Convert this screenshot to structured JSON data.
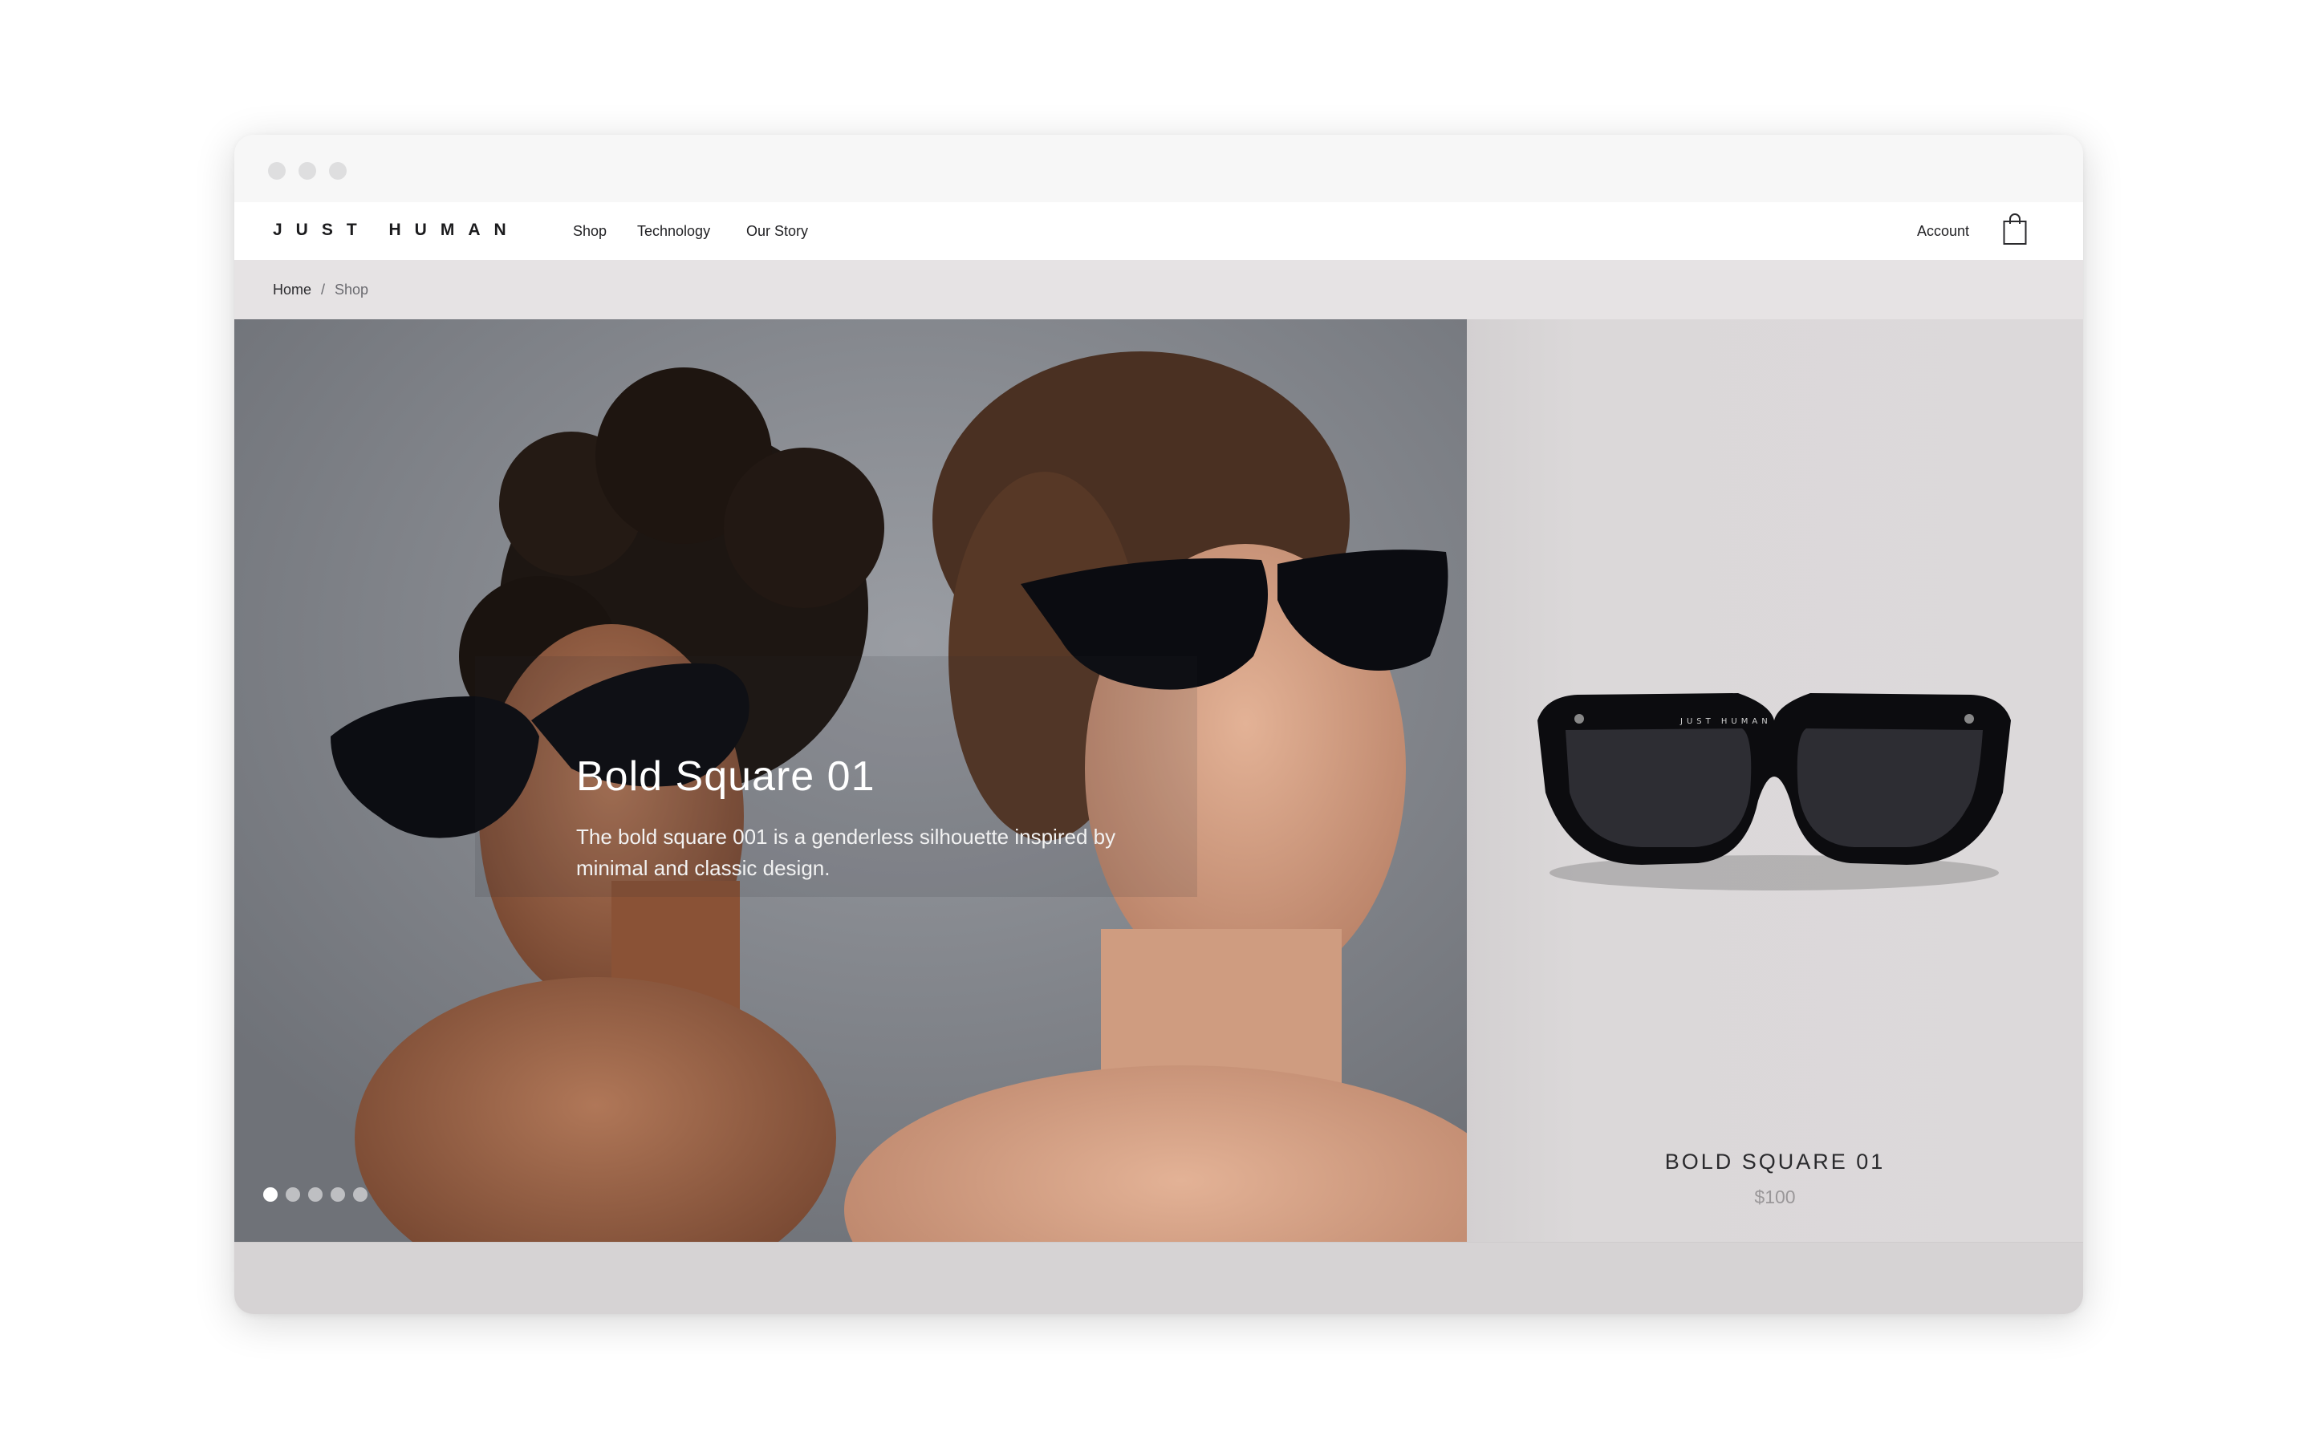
{
  "nav": {
    "logo": "JUST HUMAN",
    "links": [
      "Shop",
      "Technology",
      "Our Story"
    ],
    "account": "Account",
    "cart_icon": "shopping-bag-icon"
  },
  "breadcrumb": {
    "home": "Home",
    "separator": "/",
    "current": "Shop"
  },
  "hero": {
    "title": "Bold Square 01",
    "description": "The bold square 001 is a genderless silhouette inspired by minimal and classic design.",
    "slide_count": 5,
    "active_slide": 1
  },
  "product": {
    "name": "BOLD SQUARE 01",
    "price": "$100",
    "frame_imprint": "JUST HUMAN"
  },
  "colors": {
    "window_chrome": "#f7f7f7",
    "breadcrumb_bg": "#e6e3e4",
    "product_bg": "#dcd9da",
    "text_dark": "#1b1b1d",
    "price_gray": "#9a9799"
  }
}
